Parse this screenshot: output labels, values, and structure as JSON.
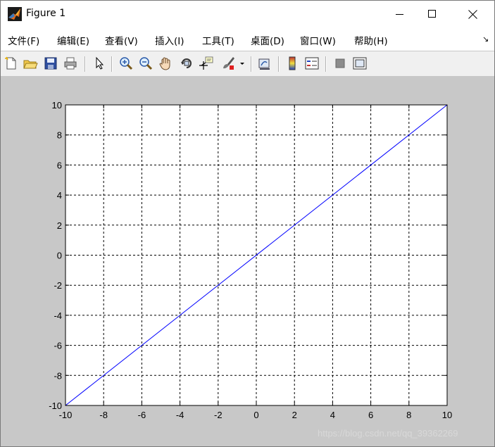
{
  "window": {
    "title": "Figure 1"
  },
  "menu": [
    {
      "label": "文件(F)"
    },
    {
      "label": "编辑(E)"
    },
    {
      "label": "查看(V)"
    },
    {
      "label": "插入(I)"
    },
    {
      "label": "工具(T)"
    },
    {
      "label": "桌面(D)"
    },
    {
      "label": "窗口(W)"
    },
    {
      "label": "帮助(H)"
    }
  ],
  "toolbar": {
    "buttons": [
      "new-figure-icon",
      "open-file-icon",
      "save-icon",
      "print-icon",
      "pointer-icon",
      "zoom-in-icon",
      "zoom-out-icon",
      "pan-hand-icon",
      "rotate-3d-icon",
      "data-cursor-icon",
      "brush-icon",
      "brush-dropdown-icon",
      "link-plot-icon",
      "colorbar-icon",
      "legend-icon",
      "hide-plot-tools-icon",
      "show-plot-tools-icon"
    ]
  },
  "watermark": "https://blog.csdn.net/qq_39362269",
  "chart_data": {
    "type": "line",
    "title": "",
    "xlabel": "",
    "ylabel": "",
    "xlim": [
      -10,
      10
    ],
    "ylim": [
      -10,
      10
    ],
    "xticks": [
      -10,
      -8,
      -6,
      -4,
      -2,
      0,
      2,
      4,
      6,
      8,
      10
    ],
    "yticks": [
      -10,
      -8,
      -6,
      -4,
      -2,
      0,
      2,
      4,
      6,
      8,
      10
    ],
    "grid": true,
    "grid_style": "dashed",
    "series": [
      {
        "color": "#0000ff",
        "x": [
          -10,
          10
        ],
        "y": [
          -10,
          10
        ]
      }
    ]
  }
}
